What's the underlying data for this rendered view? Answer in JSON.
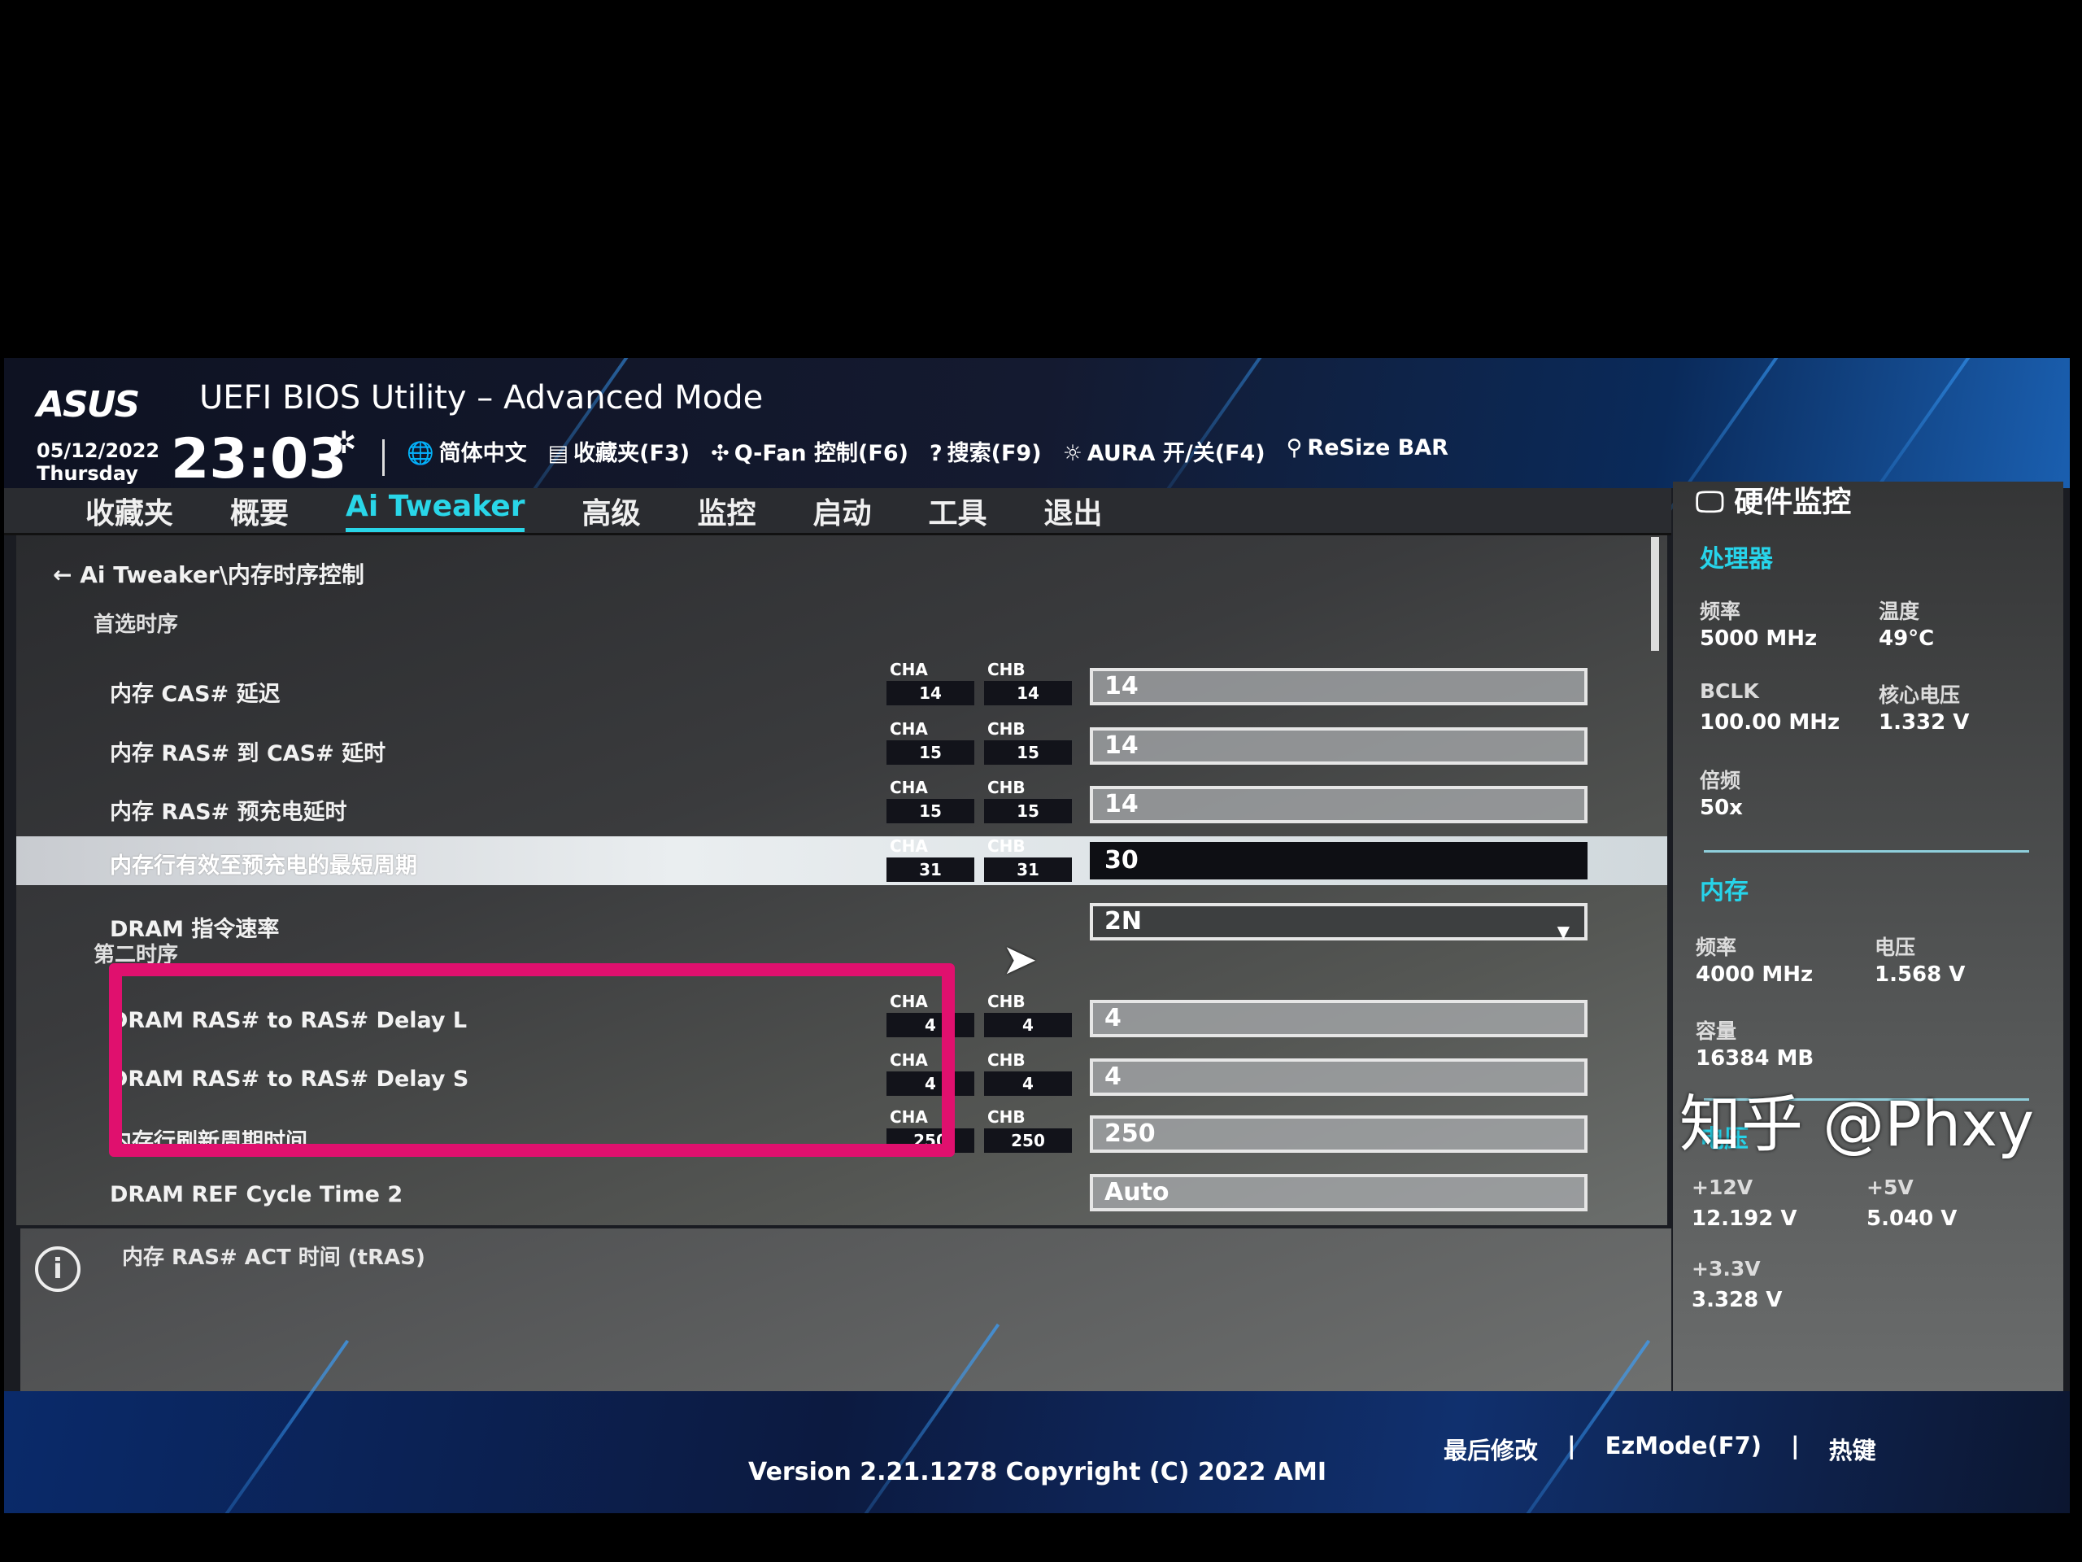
{
  "header": {
    "brand": "ASUS",
    "title": "UEFI BIOS Utility – Advanced Mode",
    "date": "05/12/2022",
    "weekday": "Thursday",
    "time": "23:03",
    "toolbar": [
      {
        "icon": "globe-icon",
        "glyph": "🌐",
        "label": "简体中文"
      },
      {
        "icon": "favorites-icon",
        "glyph": "▤",
        "label": "收藏夹(F3)"
      },
      {
        "icon": "fan-icon",
        "glyph": "✣",
        "label": "Q-Fan 控制(F6)"
      },
      {
        "icon": "help-search-icon",
        "glyph": "?",
        "label": "搜索(F9)"
      },
      {
        "icon": "aura-icon",
        "glyph": "☼",
        "label": "AURA 开/关(F4)"
      },
      {
        "icon": "resize-bar-icon",
        "glyph": "⚲",
        "label": "ReSize BAR"
      }
    ]
  },
  "nav": {
    "tabs": [
      {
        "label": "收藏夹"
      },
      {
        "label": "概要"
      },
      {
        "label": "Ai Tweaker",
        "active": true
      },
      {
        "label": "高级"
      },
      {
        "label": "监控"
      },
      {
        "label": "启动"
      },
      {
        "label": "工具"
      },
      {
        "label": "退出"
      }
    ]
  },
  "main": {
    "breadcrumb": "Ai Tweaker\\内存时序控制",
    "section1": "首选时序",
    "section2": "第二时序",
    "rows": [
      {
        "label": "内存 CAS# 延迟",
        "cha": "14",
        "chb": "14",
        "value": "14"
      },
      {
        "label": "内存 RAS# 到 CAS# 延时",
        "cha": "15",
        "chb": "15",
        "value": "14"
      },
      {
        "label": "内存 RAS# 预充电延时",
        "cha": "15",
        "chb": "15",
        "value": "14"
      },
      {
        "label": "内存行有效至预充电的最短周期",
        "cha": "31",
        "chb": "31",
        "value": "30",
        "selected": true
      },
      {
        "label": "DRAM 指令速率",
        "value": "2N",
        "dropdown": true
      },
      {
        "label": "DRAM RAS# to RAS# Delay L",
        "cha": "4",
        "chb": "4",
        "value": "4"
      },
      {
        "label": "DRAM RAS# to RAS# Delay S",
        "cha": "4",
        "chb": "4",
        "value": "4"
      },
      {
        "label": "内存行刷新周期时间",
        "cha": "250",
        "chb": "250",
        "value": "250"
      },
      {
        "label": "DRAM REF Cycle Time 2",
        "value": "Auto"
      }
    ],
    "cha_label": "CHA",
    "chb_label": "CHB",
    "info": "内存 RAS# ACT 时间 (tRAS)"
  },
  "hw": {
    "title": "硬件监控",
    "cpu": {
      "heading": "处理器",
      "freq_k": "频率",
      "freq_v": "5000 MHz",
      "temp_k": "温度",
      "temp_v": "49°C",
      "bclk_k": "BCLK",
      "bclk_v": "100.00 MHz",
      "vcore_k": "核心电压",
      "vcore_v": "1.332 V",
      "ratio_k": "倍频",
      "ratio_v": "50x"
    },
    "mem": {
      "heading": "内存",
      "freq_k": "频率",
      "freq_v": "4000 MHz",
      "volt_k": "电压",
      "volt_v": "1.568 V",
      "cap_k": "容量",
      "cap_v": "16384 MB"
    },
    "volt": {
      "heading": "电压",
      "v12_k": "+12V",
      "v12_v": "12.192 V",
      "v5_k": "+5V",
      "v5_v": "5.040 V",
      "v33_k": "+3.3V",
      "v33_v": "3.328 V"
    }
  },
  "footer": {
    "version": "Version 2.21.1278 Copyright (C) 2022 AMI",
    "last_modified": "最后修改",
    "ezmode": "EzMode(F7)",
    "hotkeys": "热键"
  },
  "watermark": "知乎 @Phxy",
  "colors": {
    "accent": "#29d6e8",
    "highlight_box": "#e0106e"
  }
}
